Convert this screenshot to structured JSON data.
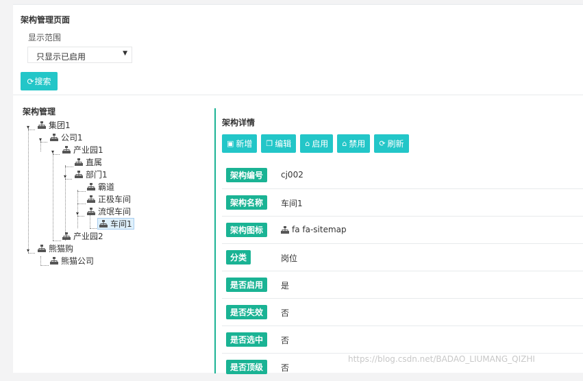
{
  "page": {
    "title": "架构管理页面"
  },
  "filter": {
    "scope_label": "显示范围",
    "scope_value": "只显示已启用",
    "search_label": "搜索"
  },
  "tree": {
    "title": "架构管理",
    "nodes": [
      "集团1",
      "公司1",
      "产业园1",
      "直属",
      "部门1",
      "霸道",
      "正极车间",
      "流氓车间",
      "车间1",
      "产业园2",
      "熊猫购",
      "熊猫公司"
    ]
  },
  "detail": {
    "title": "架构详情",
    "toolbar": {
      "add": "新增",
      "edit": "编辑",
      "enable": "启用",
      "disable": "禁用",
      "refresh": "刷新"
    },
    "rows": [
      {
        "label": "架构编号",
        "value": "cj002"
      },
      {
        "label": "架构名称",
        "value": "车间1"
      },
      {
        "label": "架构图标",
        "value": "fa fa-sitemap"
      },
      {
        "label": "分类",
        "value": "岗位"
      },
      {
        "label": "是否启用",
        "value": "是"
      },
      {
        "label": "是否失效",
        "value": "否"
      },
      {
        "label": "是否选中",
        "value": "否"
      },
      {
        "label": "是否顶级",
        "value": "否"
      }
    ]
  },
  "watermark": "https://blog.csdn.net/BADAO_LIUMANG_QIZHI"
}
